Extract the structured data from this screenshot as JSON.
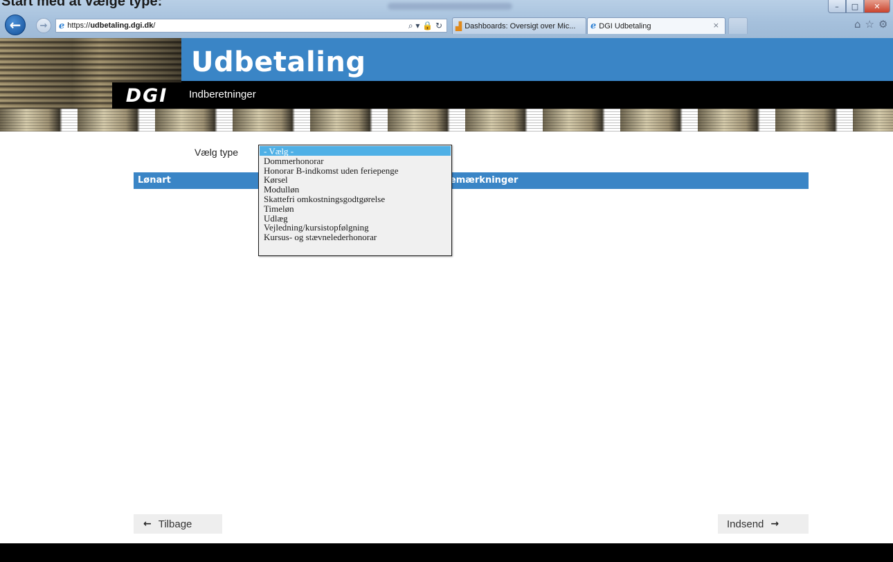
{
  "document": {
    "caption": "Start med at vælge type:"
  },
  "browser": {
    "window_buttons": {
      "minimize": "–",
      "maximize": "□",
      "close": "✕"
    },
    "address": {
      "url_prefix": "https://",
      "url_domain": "udbetaling.dgi.dk",
      "url_suffix": "/",
      "tools": "⌕ ▾ 🔒 ↻"
    },
    "tabs": [
      {
        "label": "Dashboards: Oversigt over Mic...",
        "icon": "dashboard-icon"
      },
      {
        "label": "DGI Udbetaling",
        "icon": "ie-icon",
        "close": "×"
      }
    ],
    "toolbar": {
      "home": "⌂",
      "favorites": "☆",
      "settings": "⚙"
    }
  },
  "header": {
    "title": "Udbetaling",
    "subtitle": "Indberetninger",
    "logo": "DGI",
    "colors": {
      "brand_blue": "#3a85c6",
      "brand_black": "#000000"
    }
  },
  "form": {
    "type_label": "Vælg type",
    "type_select": {
      "selected_index": 0,
      "options": [
        "- Vælg -",
        "Dommerhonorar",
        "Honorar B-indkomst uden feriepenge",
        "Kørsel",
        "Modulløn",
        "Skattefri omkostningsgodtgørelse",
        "Timeløn",
        "Udlæg",
        "Vejledning/kursistopfølgning",
        "Kursus- og stævnelederhonorar"
      ],
      "highlight_color": "#4fb0e6"
    },
    "table": {
      "columns": [
        "Lønart",
        "Bemærkninger"
      ]
    }
  },
  "footer": {
    "back_label": "Tilbage",
    "submit_label": "Indsend",
    "back_arrow": "←",
    "submit_arrow": "→"
  }
}
